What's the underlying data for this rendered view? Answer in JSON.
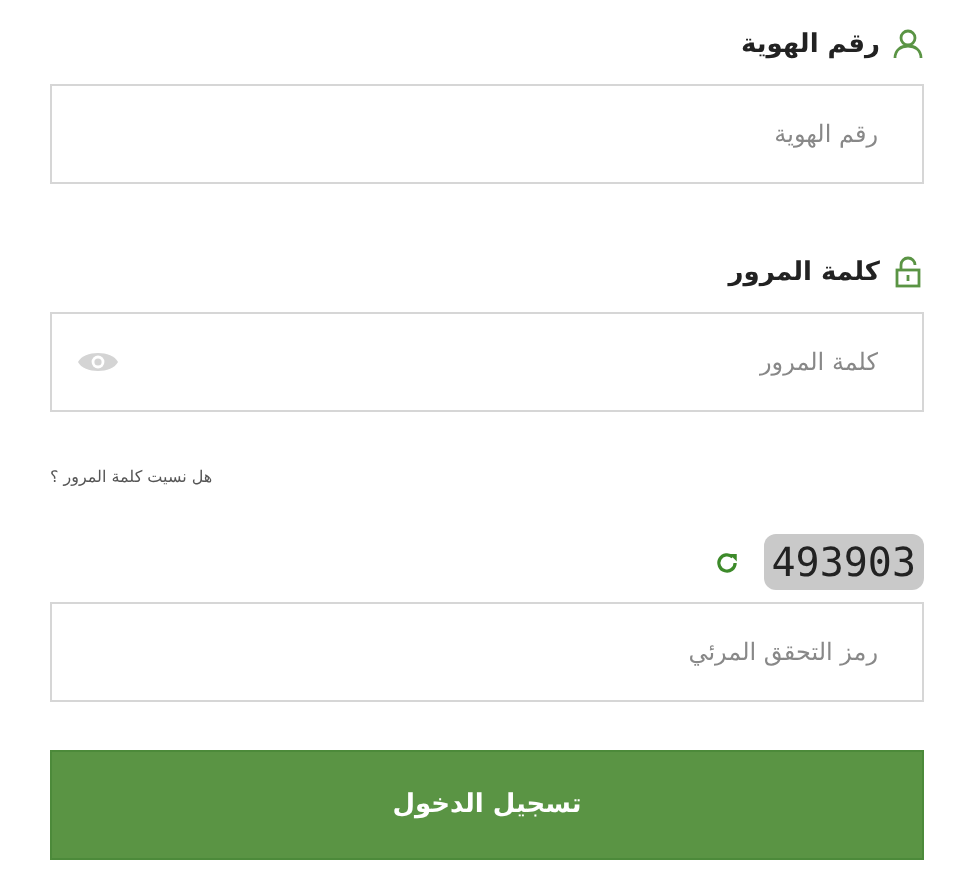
{
  "id_field": {
    "label": "رقم الهوية",
    "placeholder": "رقم الهوية"
  },
  "password_field": {
    "label": "كلمة المرور",
    "placeholder": "كلمة المرور"
  },
  "forgot_link": "هل نسيت كلمة المرور ؟",
  "captcha": {
    "code": "493903",
    "placeholder": "رمز التحقق المرئي"
  },
  "login_button": "تسجيل الدخول"
}
